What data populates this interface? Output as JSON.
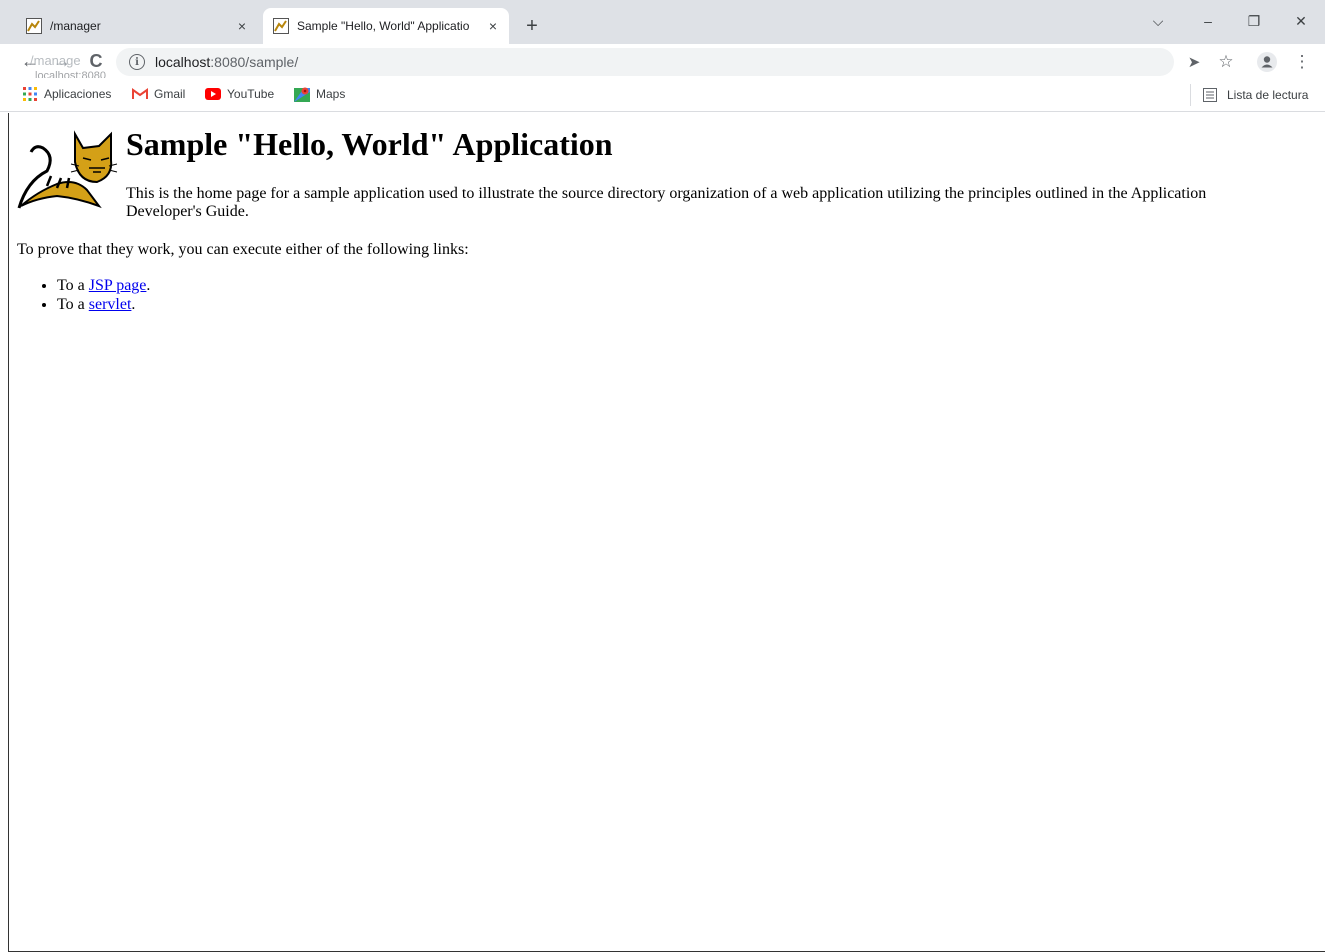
{
  "tabs": [
    {
      "title": "/manager",
      "active": false
    },
    {
      "title": "Sample \"Hello, World\" Applicatio",
      "active": true
    }
  ],
  "tab_close_glyph": "×",
  "new_tab_glyph": "+",
  "window_controls": {
    "tab_search": "⌵",
    "minimize": "–",
    "restore": "❐",
    "close": "✕"
  },
  "toolbar": {
    "back": "←",
    "forward": "→",
    "reload": "C",
    "url_host": "localhost",
    "url_path": ":8080/sample/",
    "share": "➤",
    "bookmark_star": "☆",
    "menu": "⋮"
  },
  "hover_tooltip": {
    "title": "/manage",
    "url": "localhost:8080"
  },
  "bookmarks": [
    {
      "label": "Aplicaciones",
      "icon": "apps-grid-icon"
    },
    {
      "label": "Gmail",
      "icon": "gmail-icon"
    },
    {
      "label": "YouTube",
      "icon": "youtube-icon"
    },
    {
      "label": "Maps",
      "icon": "maps-icon"
    }
  ],
  "reading_list": "Lista de lectura",
  "page": {
    "heading": "Sample \"Hello, World\" Application",
    "intro": "This is the home page for a sample application used to illustrate the source directory organization of a web application utilizing the principles outlined in the Application Developer's Guide.",
    "prove": "To prove that they work, you can execute either of the following links:",
    "links": [
      {
        "prefix": "To a ",
        "link": "JSP page",
        "suffix": "."
      },
      {
        "prefix": "To a ",
        "link": "servlet",
        "suffix": "."
      }
    ]
  },
  "colors": {
    "tabstrip": "#dee1e6",
    "link": "#0000ee",
    "tomcat_yellow": "#d4a017"
  }
}
